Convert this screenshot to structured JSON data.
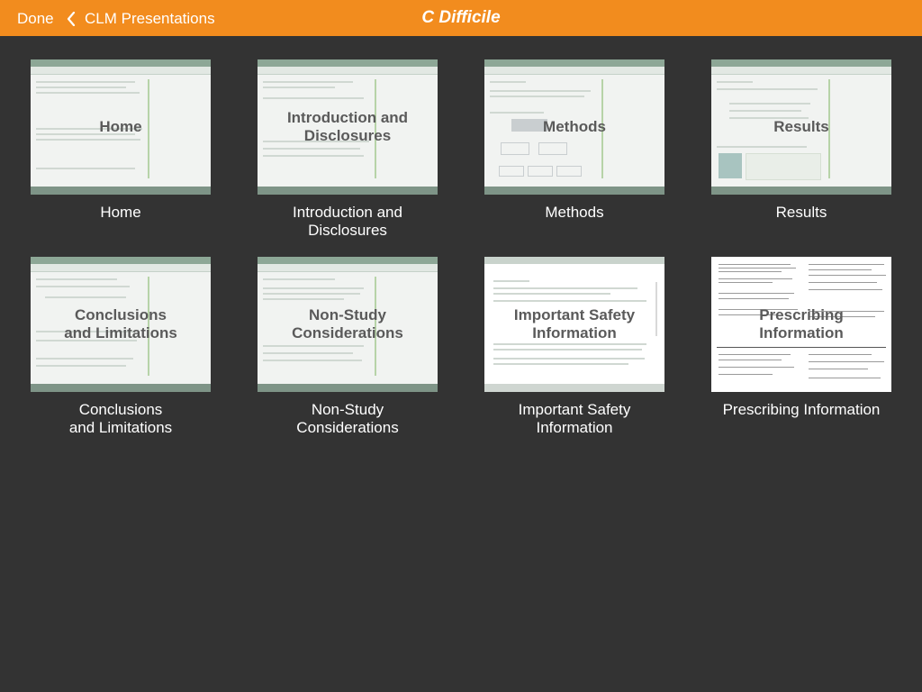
{
  "header": {
    "done_label": "Done",
    "back_label": "CLM Presentations",
    "title": "C Difficile"
  },
  "tiles": [
    {
      "thumb_label": "Home",
      "caption": "Home"
    },
    {
      "thumb_label": "Introduction and\nDisclosures",
      "caption": "Introduction and\nDisclosures"
    },
    {
      "thumb_label": "Methods",
      "caption": "Methods"
    },
    {
      "thumb_label": "Results",
      "caption": "Results"
    },
    {
      "thumb_label": "Conclusions\nand Limitations",
      "caption": "Conclusions\nand Limitations"
    },
    {
      "thumb_label": "Non-Study\nConsiderations",
      "caption": "Non-Study\nConsiderations"
    },
    {
      "thumb_label": "Important Safety\nInformation",
      "caption": "Important Safety\nInformation"
    },
    {
      "thumb_label": "Prescribing\nInformation",
      "caption": "Prescribing Information"
    }
  ],
  "colors": {
    "header_bg": "#f28c1e",
    "page_bg": "#333333"
  }
}
